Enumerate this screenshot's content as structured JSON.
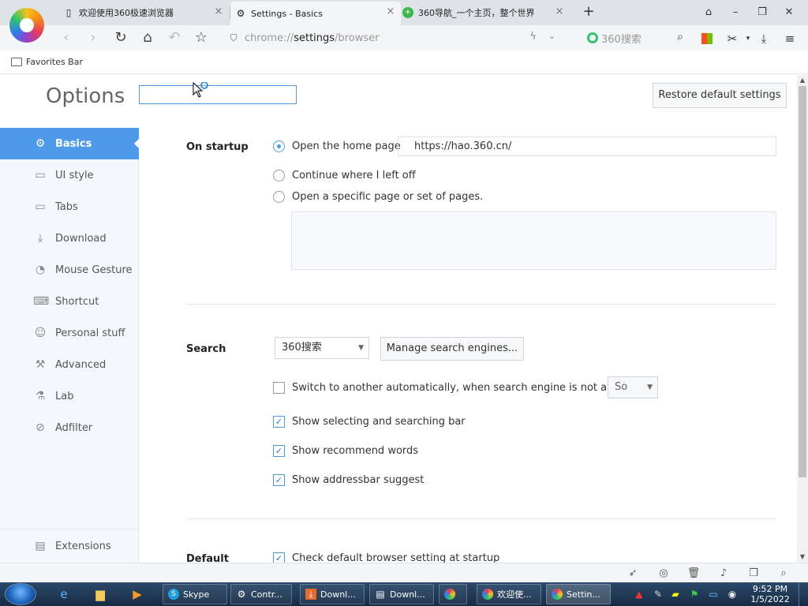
{
  "tabs": [
    {
      "title": "欢迎使用360极速浏览器",
      "icon": "document-icon"
    },
    {
      "title": "Settings - Basics",
      "icon": "gear-icon"
    },
    {
      "title": "360导航_一个主页，整个世界",
      "icon": "360-nav-icon"
    }
  ],
  "toolbar": {
    "url_scheme": "chrome://",
    "url_host": "settings",
    "url_path": "/browser",
    "search_engine_label": "360搜索"
  },
  "favorites_bar": {
    "label": "Favorites Bar"
  },
  "page": {
    "title": "Options",
    "search_value": "",
    "restore_label": "Restore default settings"
  },
  "sidebar": {
    "items": [
      {
        "label": "Basics",
        "icon": "gear-icon",
        "active": true
      },
      {
        "label": "UI style",
        "icon": "window-icon"
      },
      {
        "label": "Tabs",
        "icon": "tab-icon"
      },
      {
        "label": "Download",
        "icon": "download-icon"
      },
      {
        "label": "Mouse Gesture",
        "icon": "mouse-icon"
      },
      {
        "label": "Shortcut",
        "icon": "shortcut-icon"
      },
      {
        "label": "Personal stuff",
        "icon": "person-icon"
      },
      {
        "label": "Advanced",
        "icon": "wrench-icon"
      },
      {
        "label": "Lab",
        "icon": "flask-icon"
      },
      {
        "label": "Adfilter",
        "icon": "block-icon"
      }
    ],
    "extensions_label": "Extensions"
  },
  "startup": {
    "label": "On startup",
    "option_home": "Open the home page",
    "home_url": "https://hao.360.cn/",
    "option_continue": "Continue where I left off",
    "option_specific": "Open a specific page or set of pages.",
    "selected": "home"
  },
  "search": {
    "label": "Search",
    "engine": "360搜索",
    "manage_label": "Manage search engines...",
    "switch_label": "Switch to another automatically, when search engine is not available",
    "switch_checked": false,
    "fallback_engine": "So",
    "show_bar_label": "Show selecting and searching bar",
    "show_bar_checked": true,
    "recommend_label": "Show recommend words",
    "recommend_checked": true,
    "suggest_label": "Show addressbar suggest",
    "suggest_checked": true
  },
  "default": {
    "label": "Default",
    "check_label": "Check default browser setting at startup",
    "check_checked": true
  },
  "taskbar": {
    "items": [
      {
        "label": "Skype"
      },
      {
        "label": "Contr..."
      },
      {
        "label": "Downl..."
      },
      {
        "label": "Downl..."
      },
      {
        "label": ""
      },
      {
        "label": "欢迎使..."
      },
      {
        "label": "Settin..."
      }
    ],
    "time": "9:52 PM",
    "date": "1/5/2022"
  },
  "colors": {
    "accent": "#4f9ae8",
    "sidebar_bg": "#f4f7fb",
    "taskbar": "#1d3551"
  }
}
